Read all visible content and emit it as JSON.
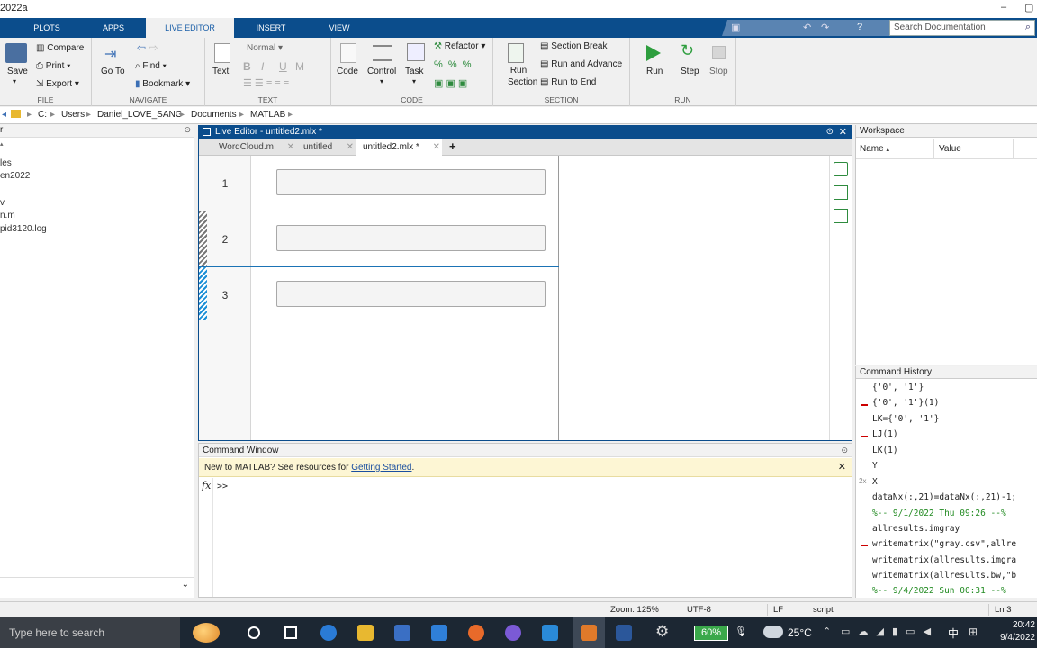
{
  "window": {
    "title": "2022a"
  },
  "ribbon_tabs": [
    "PLOTS",
    "APPS",
    "LIVE EDITOR",
    "INSERT",
    "VIEW"
  ],
  "search": {
    "placeholder": "Search Documentation"
  },
  "ribbon": {
    "file": {
      "label": "FILE",
      "save": "Save",
      "compare": "Compare",
      "print": "Print",
      "export": "Export"
    },
    "navigate": {
      "label": "NAVIGATE",
      "goto": "Go To",
      "find": "Find",
      "bookmark": "Bookmark"
    },
    "text": {
      "label": "TEXT",
      "text": "Text",
      "style": "Normal"
    },
    "code": {
      "label": "CODE",
      "code": "Code",
      "control": "Control",
      "task": "Task",
      "refactor": "Refactor"
    },
    "section": {
      "label": "SECTION",
      "run_section": "Run Section",
      "section_break": "Section Break",
      "run_advance": "Run and Advance",
      "run_end": "Run to End"
    },
    "run": {
      "label": "RUN",
      "run": "Run",
      "step": "Step",
      "stop": "Stop"
    }
  },
  "path": [
    "C:",
    "Users",
    "Daniel_LOVE_SANG",
    "Documents",
    "MATLAB"
  ],
  "left_panel": {
    "items": [
      "les",
      "en2022",
      "v",
      "n.m",
      "pid3120.log"
    ]
  },
  "editor": {
    "title": "Live Editor - untitled2.mlx *",
    "tabs": [
      "WordCloud.m",
      "untitled",
      "untitled2.mlx *"
    ],
    "lines": [
      "1",
      "2",
      "3"
    ]
  },
  "workspace": {
    "title": "Workspace",
    "col_name": "Name",
    "col_value": "Value"
  },
  "command_history": {
    "title": "Command History",
    "entries": [
      "{'0', '1'}",
      "{'0', '1'}(1)",
      "LK={'0', '1'}",
      "LJ(1)",
      "LK(1)",
      "Y",
      "X",
      "dataNx(:,21)=dataNx(:,21)-1;",
      "%-- 9/1/2022 Thu 09:26 --%",
      "allresults.imgray",
      "writematrix(\"gray.csv\",allre",
      "writematrix(allresults.imgra",
      "writematrix(allresults.bw,\"b",
      "%-- 9/4/2022 Sun 00:31 --%"
    ],
    "repeat_badge": "2x"
  },
  "command_window": {
    "title": "Command Window",
    "banner": "New to MATLAB? See resources for",
    "banner_link": "Getting Started",
    "banner_period": ".",
    "fx": "fx",
    "prompt": ">>"
  },
  "status": {
    "zoom": "Zoom: 125%",
    "encoding": "UTF-8",
    "eol": "LF",
    "type": "script",
    "line": "Ln 3"
  },
  "taskbar": {
    "search": "Type here to search",
    "battery": "60%",
    "temp": "25°C",
    "ime": "中",
    "time": "20:42",
    "date": "9/4/2022"
  },
  "colors": {
    "accent": "#0b4d8c",
    "history_error": "#cc0000",
    "comment": "#228b22",
    "run_green": "#2e9e3e"
  }
}
